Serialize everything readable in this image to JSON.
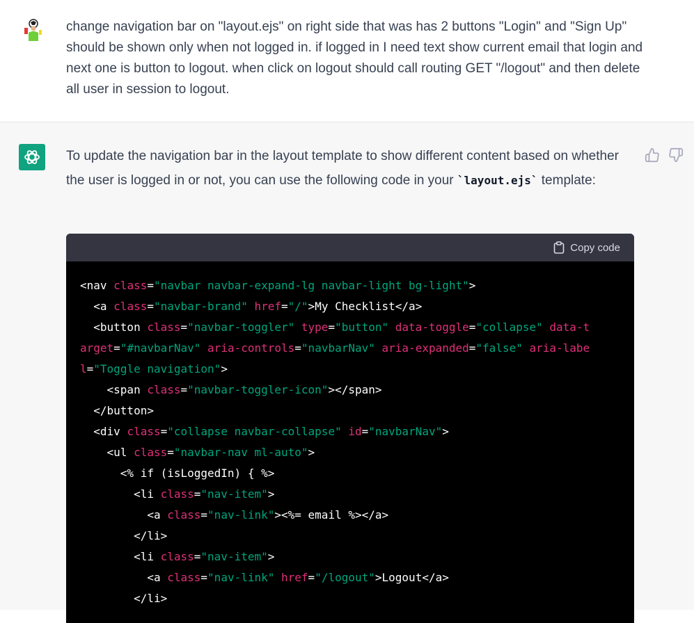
{
  "user_message": {
    "text": "change navigation bar on \"layout.ejs\" on right side that was has 2 buttons \"Login\" and \"Sign Up\" should be shown only when not logged in. if logged in I need text show current email that login and next one is button to logout. when click on logout should call routing GET \"/logout\" and then delete all user in session to logout."
  },
  "assistant_message": {
    "intro_before": "To update the navigation bar in the layout template to show different content based on whether the user is logged in or not, you can use the following code in your ",
    "intro_code": "`layout.ejs`",
    "intro_after": " template:",
    "copy_label": "Copy code",
    "code_lines": [
      [
        [
          "t",
          "<nav "
        ],
        [
          "a",
          "class"
        ],
        [
          "t",
          "="
        ],
        [
          "s",
          "\"navbar navbar-expand-lg navbar-light bg-light\""
        ],
        [
          "t",
          ">"
        ]
      ],
      [
        [
          "t",
          "  <a "
        ],
        [
          "a",
          "class"
        ],
        [
          "t",
          "="
        ],
        [
          "s",
          "\"navbar-brand\""
        ],
        [
          "t",
          " "
        ],
        [
          "a",
          "href"
        ],
        [
          "t",
          "="
        ],
        [
          "s",
          "\"/\""
        ],
        [
          "t",
          ">My Checklist</a>"
        ]
      ],
      [
        [
          "t",
          "  <button "
        ],
        [
          "a",
          "class"
        ],
        [
          "t",
          "="
        ],
        [
          "s",
          "\"navbar-toggler\""
        ],
        [
          "t",
          " "
        ],
        [
          "a",
          "type"
        ],
        [
          "t",
          "="
        ],
        [
          "s",
          "\"button\""
        ],
        [
          "t",
          " "
        ],
        [
          "a",
          "data-toggle"
        ],
        [
          "t",
          "="
        ],
        [
          "s",
          "\"collapse\""
        ],
        [
          "t",
          " "
        ],
        [
          "a",
          "data-target"
        ],
        [
          "t",
          "="
        ],
        [
          "s",
          "\"#navbarNav\""
        ],
        [
          "t",
          " "
        ],
        [
          "a",
          "aria-controls"
        ],
        [
          "t",
          "="
        ],
        [
          "s",
          "\"navbarNav\""
        ],
        [
          "t",
          " "
        ],
        [
          "a",
          "aria-expanded"
        ],
        [
          "t",
          "="
        ],
        [
          "s",
          "\"false\""
        ],
        [
          "t",
          " "
        ],
        [
          "a",
          "aria-label"
        ],
        [
          "t",
          "="
        ],
        [
          "s",
          "\"Toggle navigation\""
        ],
        [
          "t",
          ">"
        ]
      ],
      [
        [
          "t",
          "    <span "
        ],
        [
          "a",
          "class"
        ],
        [
          "t",
          "="
        ],
        [
          "s",
          "\"navbar-toggler-icon\""
        ],
        [
          "t",
          "></span>"
        ]
      ],
      [
        [
          "t",
          "  </button>"
        ]
      ],
      [
        [
          "t",
          "  <div "
        ],
        [
          "a",
          "class"
        ],
        [
          "t",
          "="
        ],
        [
          "s",
          "\"collapse navbar-collapse\""
        ],
        [
          "t",
          " "
        ],
        [
          "a",
          "id"
        ],
        [
          "t",
          "="
        ],
        [
          "s",
          "\"navbarNav\""
        ],
        [
          "t",
          ">"
        ]
      ],
      [
        [
          "t",
          "    <ul "
        ],
        [
          "a",
          "class"
        ],
        [
          "t",
          "="
        ],
        [
          "s",
          "\"navbar-nav ml-auto\""
        ],
        [
          "t",
          ">"
        ]
      ],
      [
        [
          "t",
          "      <% if (isLoggedIn) { %>"
        ]
      ],
      [
        [
          "t",
          "        <li "
        ],
        [
          "a",
          "class"
        ],
        [
          "t",
          "="
        ],
        [
          "s",
          "\"nav-item\""
        ],
        [
          "t",
          ">"
        ]
      ],
      [
        [
          "t",
          "          <a "
        ],
        [
          "a",
          "class"
        ],
        [
          "t",
          "="
        ],
        [
          "s",
          "\"nav-link\""
        ],
        [
          "t",
          "><%= email %></a>"
        ]
      ],
      [
        [
          "t",
          "        </li>"
        ]
      ],
      [
        [
          "t",
          "        <li "
        ],
        [
          "a",
          "class"
        ],
        [
          "t",
          "="
        ],
        [
          "s",
          "\"nav-item\""
        ],
        [
          "t",
          ">"
        ]
      ],
      [
        [
          "t",
          "          <a "
        ],
        [
          "a",
          "class"
        ],
        [
          "t",
          "="
        ],
        [
          "s",
          "\"nav-link\""
        ],
        [
          "t",
          " "
        ],
        [
          "a",
          "href"
        ],
        [
          "t",
          "="
        ],
        [
          "s",
          "\"/logout\""
        ],
        [
          "t",
          ">Logout</a>"
        ]
      ],
      [
        [
          "t",
          "        </li>"
        ]
      ]
    ]
  },
  "colors": {
    "accent": "#10a37f",
    "code_attr": "#df3079",
    "code_string": "#00a67d",
    "code_bg": "#000000",
    "code_header_bg": "#343541"
  }
}
